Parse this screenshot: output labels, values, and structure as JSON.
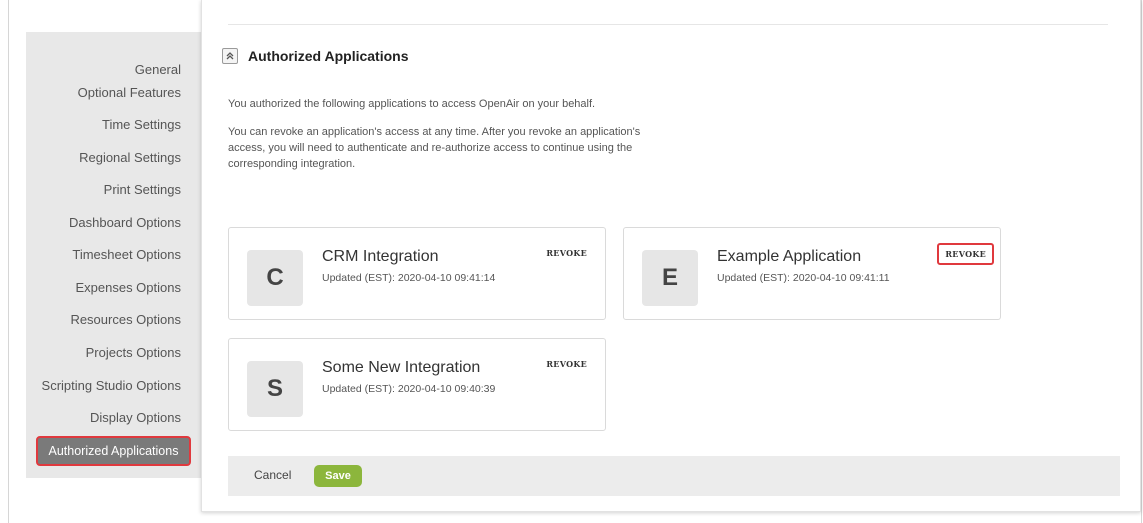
{
  "sidebar": {
    "items": [
      {
        "label": "General"
      },
      {
        "label": "Optional Features"
      },
      {
        "label": "Time Settings"
      },
      {
        "label": "Regional Settings"
      },
      {
        "label": "Print Settings"
      },
      {
        "label": "Dashboard Options"
      },
      {
        "label": "Timesheet Options"
      },
      {
        "label": "Expenses Options"
      },
      {
        "label": "Resources Options"
      },
      {
        "label": "Projects Options"
      },
      {
        "label": "Scripting Studio Options"
      },
      {
        "label": "Display Options"
      },
      {
        "label": "Authorized Applications",
        "active": true
      }
    ]
  },
  "section": {
    "title": "Authorized Applications",
    "icon": "chevron-double-up-icon"
  },
  "description": {
    "line1": "You authorized the following applications to access OpenAir on your behalf.",
    "line2": "You can revoke an application's access at any time. After you revoke an application's access, you will need to authenticate and re-authorize access to continue using the corresponding integration."
  },
  "applications": [
    {
      "initial": "C",
      "name": "CRM Integration",
      "updated": "Updated (EST): 2020-04-10 09:41:14",
      "revoke_label": "REVOKE"
    },
    {
      "initial": "E",
      "name": "Example Application",
      "updated": "Updated (EST): 2020-04-10 09:41:11",
      "revoke_label": "REVOKE"
    },
    {
      "initial": "S",
      "name": "Some New Integration",
      "updated": "Updated (EST): 2020-04-10 09:40:39",
      "revoke_label": "REVOKE"
    }
  ],
  "footer": {
    "cancel_label": "Cancel",
    "save_label": "Save"
  },
  "colors": {
    "save": "#8cb63c",
    "highlight": "#e0393e",
    "sidebar_bg": "#e8e8e8",
    "sidebar_active": "#7a7a7a"
  }
}
